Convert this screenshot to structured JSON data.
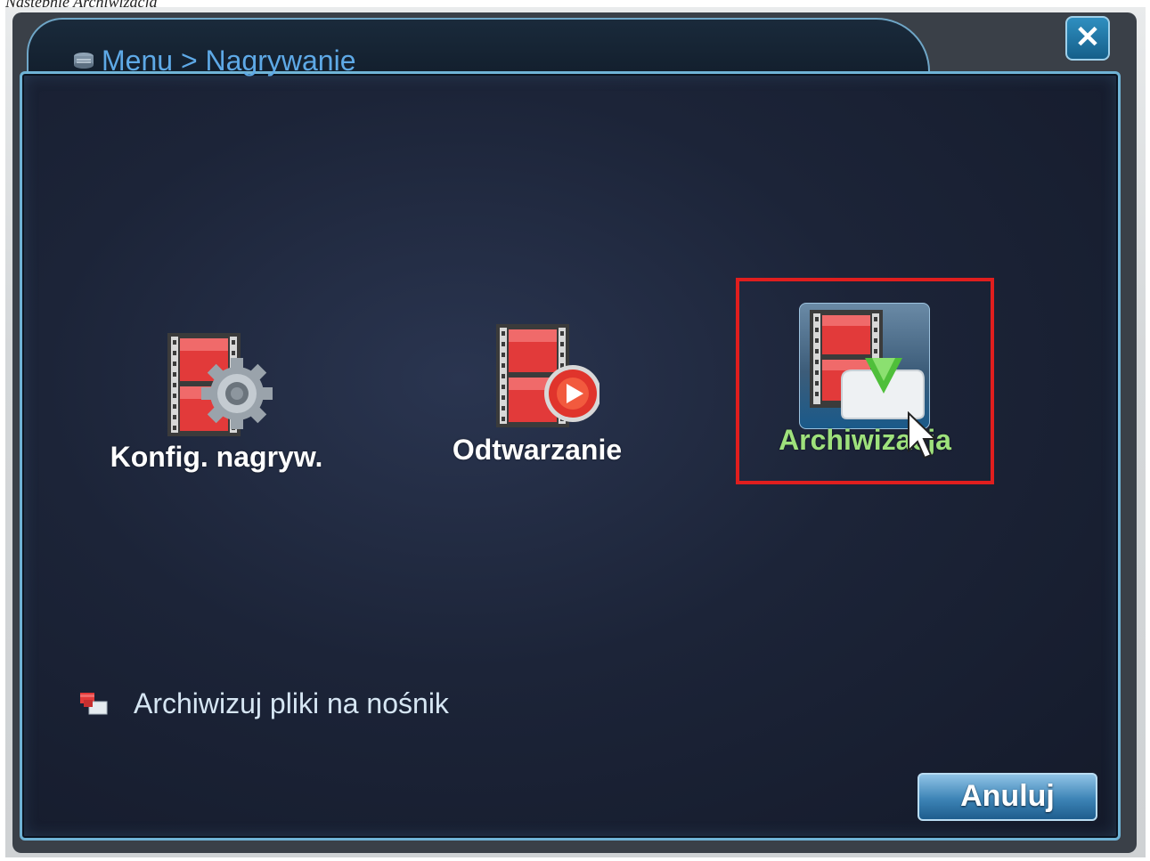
{
  "caption": "Następnie Archiwizacja",
  "window": {
    "breadcrumb": "Menu > Nagrywanie",
    "close_symbol": "✕"
  },
  "menu_items": [
    {
      "label": "Konfig. nagryw.",
      "icon": "film-gear-icon",
      "selected": false
    },
    {
      "label": "Odtwarzanie",
      "icon": "film-play-icon",
      "selected": false
    },
    {
      "label": "Archiwizacja",
      "icon": "film-download-icon",
      "selected": true
    }
  ],
  "hint_text": "Archiwizuj pliki na nośnik",
  "buttons": {
    "cancel": "Anuluj"
  },
  "colors": {
    "accent": "#6fb3d6",
    "selected_label": "#9ee17c",
    "highlight_box": "#e01e1e",
    "title": "#5ea9e6"
  }
}
